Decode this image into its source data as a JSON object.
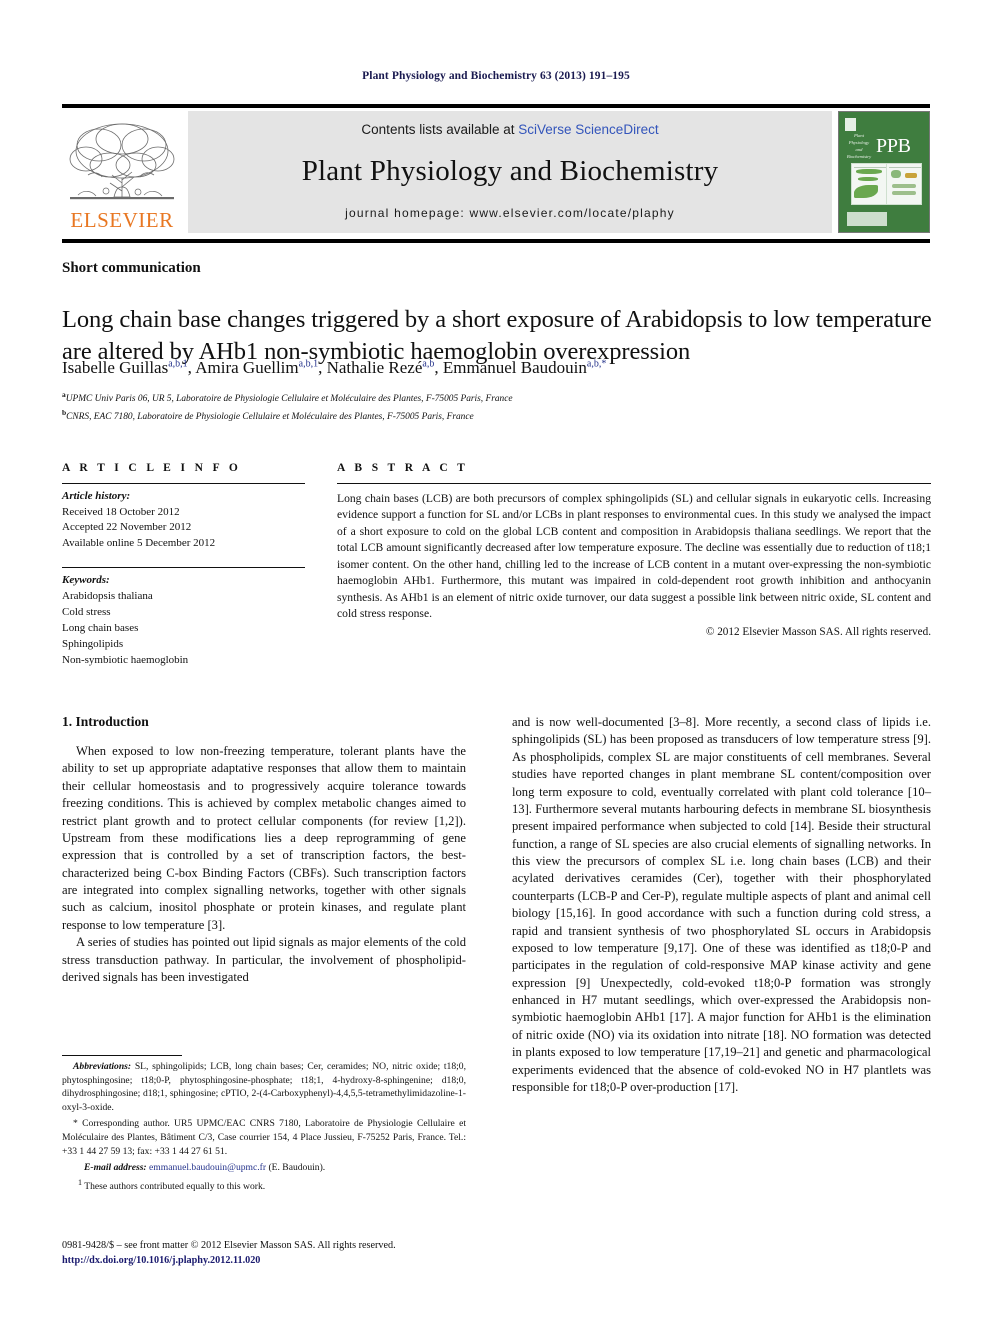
{
  "running_head": "Plant Physiology and Biochemistry 63 (2013) 191–195",
  "header": {
    "contents_prefix": "Contents lists available at ",
    "sciencedirect": "SciVerse ScienceDirect",
    "journal_title": "Plant Physiology and Biochemistry",
    "homepage": "journal homepage: www.elsevier.com/locate/plaphy",
    "elsevier_wordmark": "ELSEVIER",
    "elsevier_color": "#E87722",
    "ppb_cover": {
      "big_text": "PPB",
      "small_title_lines": [
        "Plant",
        "Physiology",
        "and",
        "Biochemistry"
      ],
      "background_color": "#3f7d3f"
    }
  },
  "article": {
    "type": "Short communication",
    "title": "Long chain base changes triggered by a short exposure of Arabidopsis to low temperature are altered by AHb1 non-symbiotic haemoglobin overexpression",
    "authors": [
      {
        "name": "Isabelle Guillas",
        "sup": "a,b,1"
      },
      {
        "name": "Amira Guellim",
        "sup": "a,b,1"
      },
      {
        "name": "Nathalie Rezé",
        "sup": "a,b"
      },
      {
        "name": "Emmanuel Baudouin",
        "sup": "a,b,*"
      }
    ],
    "affiliations": [
      {
        "marker": "a",
        "text": "UPMC Univ Paris 06, UR 5, Laboratoire de Physiologie Cellulaire et Moléculaire des Plantes, F-75005 Paris, France"
      },
      {
        "marker": "b",
        "text": "CNRS, EAC 7180, Laboratoire de Physiologie Cellulaire et Moléculaire des Plantes, F-75005 Paris, France"
      }
    ]
  },
  "article_info": {
    "heading": "A R T I C L E   I N F O",
    "history_label": "Article history:",
    "history": [
      "Received 18 October 2012",
      "Accepted 22 November 2012",
      "Available online 5 December 2012"
    ],
    "keywords_label": "Keywords:",
    "keywords": [
      "Arabidopsis thaliana",
      "Cold stress",
      "Long chain bases",
      "Sphingolipids",
      "Non-symbiotic haemoglobin"
    ]
  },
  "abstract": {
    "heading": "A B S T R A C T",
    "body": "Long chain bases (LCB) are both precursors of complex sphingolipids (SL) and cellular signals in eukaryotic cells. Increasing evidence support a function for SL and/or LCBs in plant responses to environmental cues. In this study we analysed the impact of a short exposure to cold on the global LCB content and composition in Arabidopsis thaliana seedlings. We report that the total LCB amount significantly decreased after low temperature exposure. The decline was essentially due to reduction of t18;1 isomer content. On the other hand, chilling led to the increase of LCB content in a mutant over-expressing the non-symbiotic haemoglobin AHb1. Furthermore, this mutant was impaired in cold-dependent root growth inhibition and anthocyanin synthesis. As AHb1 is an element of nitric oxide turnover, our data suggest a possible link between nitric oxide, SL content and cold stress response.",
    "copyright": "© 2012 Elsevier Masson SAS. All rights reserved."
  },
  "introduction": {
    "section_title": "1. Introduction",
    "left_paragraphs": [
      "When exposed to low non-freezing temperature, tolerant plants have the ability to set up appropriate adaptative responses that allow them to maintain their cellular homeostasis and to progressively acquire tolerance towards freezing conditions. This is achieved by complex metabolic changes aimed to restrict plant growth and to protect cellular components (for review [1,2]). Upstream from these modifications lies a deep reprogramming of gene expression that is controlled by a set of transcription factors, the best-characterized being C-box Binding Factors (CBFs). Such transcription factors are integrated into complex signalling networks, together with other signals such as calcium, inositol phosphate or protein kinases, and regulate plant response to low temperature [3].",
      "A series of studies has pointed out lipid signals as major elements of the cold stress transduction pathway. In particular, the involvement of phospholipid-derived signals has been investigated"
    ],
    "right_paragraphs": [
      "and is now well-documented [3–8]. More recently, a second class of lipids i.e. sphingolipids (SL) has been proposed as transducers of low temperature stress [9]. As phospholipids, complex SL are major constituents of cell membranes. Several studies have reported changes in plant membrane SL content/composition over long term exposure to cold, eventually correlated with plant cold tolerance [10–13]. Furthermore several mutants harbouring defects in membrane SL biosynthesis present impaired performance when subjected to cold [14]. Beside their structural function, a range of SL species are also crucial elements of signalling networks. In this view the precursors of complex SL i.e. long chain bases (LCB) and their acylated derivatives ceramides (Cer), together with their phosphorylated counterparts (LCB-P and Cer-P), regulate multiple aspects of plant and animal cell biology [15,16]. In good accordance with such a function during cold stress, a rapid and transient synthesis of two phosphorylated SL occurs in Arabidopsis exposed to low temperature [9,17]. One of these was identified as t18;0-P and participates in the regulation of cold-responsive MAP kinase activity and gene expression [9] Unexpectedly, cold-evoked t18;0-P formation was strongly enhanced in H7 mutant seedlings, which over-expressed the Arabidopsis non-symbiotic haemoglobin AHb1 [17]. A major function for AHb1 is the elimination of nitric oxide (NO) via its oxidation into nitrate [18]. NO formation was detected in plants exposed to low temperature [17,19–21] and genetic and pharmacological experiments evidenced that the absence of cold-evoked NO in H7 plantlets was responsible for t18;0-P over-production [17]."
    ]
  },
  "footnotes": {
    "abbreviations_label": "Abbreviations:",
    "abbreviations_text": "SL, sphingolipids; LCB, long chain bases; Cer, ceramides; NO, nitric oxide; t18;0, phytosphingosine; t18;0-P, phytosphingosine-phosphate; t18;1, 4-hydroxy-8-sphingenine; d18;0, dihydrosphingosine; d18;1, sphingosine; cPTIO, 2-(4-Carboxyphenyl)-4,4,5,5-tetramethylimidazoline-1-oxyl-3-oxide.",
    "corresponding": "* Corresponding author. UR5 UPMC/EAC CNRS 7180, Laboratoire de Physiologie Cellulaire et Moléculaire des Plantes, Bâtiment C/3, Case courrier 154, 4 Place Jussieu, F-75252 Paris, France. Tel.: +33 1 44 27 59 13; fax: +33 1 44 27 61 51.",
    "email_label": "E-mail address:",
    "email": "emmanuel.baudouin@upmc.fr",
    "email_suffix": " (E. Baudouin).",
    "equal_contrib_marker": "1",
    "equal_contrib": "These authors contributed equally to this work."
  },
  "imprint": {
    "line1": "0981-9428/$ – see front matter © 2012 Elsevier Masson SAS. All rights reserved.",
    "doi": "http://dx.doi.org/10.1016/j.plaphy.2012.11.020"
  }
}
